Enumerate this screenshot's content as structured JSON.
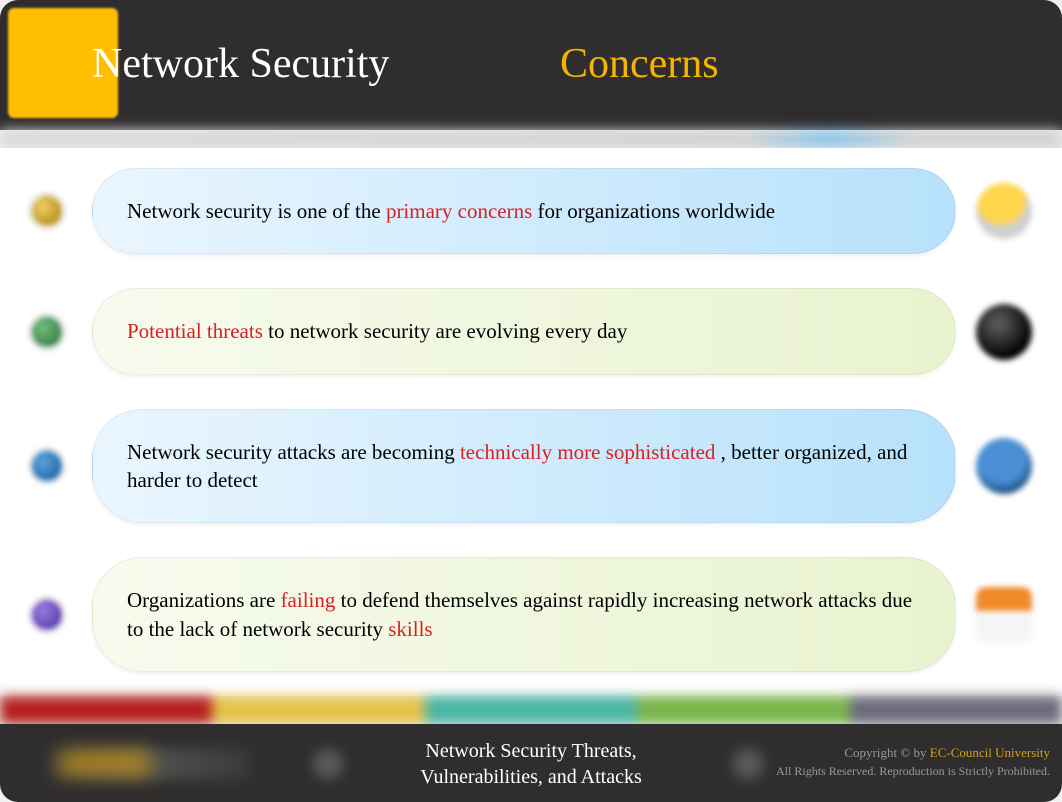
{
  "header": {
    "title_white": "Network Security",
    "title_accent": "Concerns"
  },
  "points": [
    {
      "bullet_color": "gold",
      "bubble_color": "blue",
      "side_icon": "lamp",
      "segments": [
        {
          "text": "Network security is one of the ",
          "hl": false
        },
        {
          "text": "primary concerns",
          "hl": true
        },
        {
          "text": " for organizations worldwide",
          "hl": false
        }
      ]
    },
    {
      "bullet_color": "green",
      "bubble_color": "green",
      "side_icon": "bomb",
      "segments": [
        {
          "text": "Potential threats",
          "hl": true
        },
        {
          "text": " to network security are evolving every day",
          "hl": false
        }
      ]
    },
    {
      "bullet_color": "blue",
      "bubble_color": "blue",
      "side_icon": "shield",
      "segments": [
        {
          "text": "Network security attacks are becoming ",
          "hl": false
        },
        {
          "text": "technically more sophisticated",
          "hl": true
        },
        {
          "text": ", better organized, and harder to detect",
          "hl": false
        }
      ]
    },
    {
      "bullet_color": "purple",
      "bubble_color": "green",
      "side_icon": "folder",
      "segments": [
        {
          "text": "Organizations are ",
          "hl": false
        },
        {
          "text": "failing",
          "hl": true
        },
        {
          "text": " to defend themselves against rapidly increasing network attacks due to the lack of network security ",
          "hl": false
        },
        {
          "text": "skills",
          "hl": true
        }
      ]
    }
  ],
  "footer": {
    "center_line1": "Network Security Threats,",
    "center_line2": "Vulnerabilities, and Attacks",
    "copyright_prefix": "Copyright © by ",
    "org": "EC-Council University",
    "rights": "All Rights Reserved. Reproduction is Strictly Prohibited."
  }
}
